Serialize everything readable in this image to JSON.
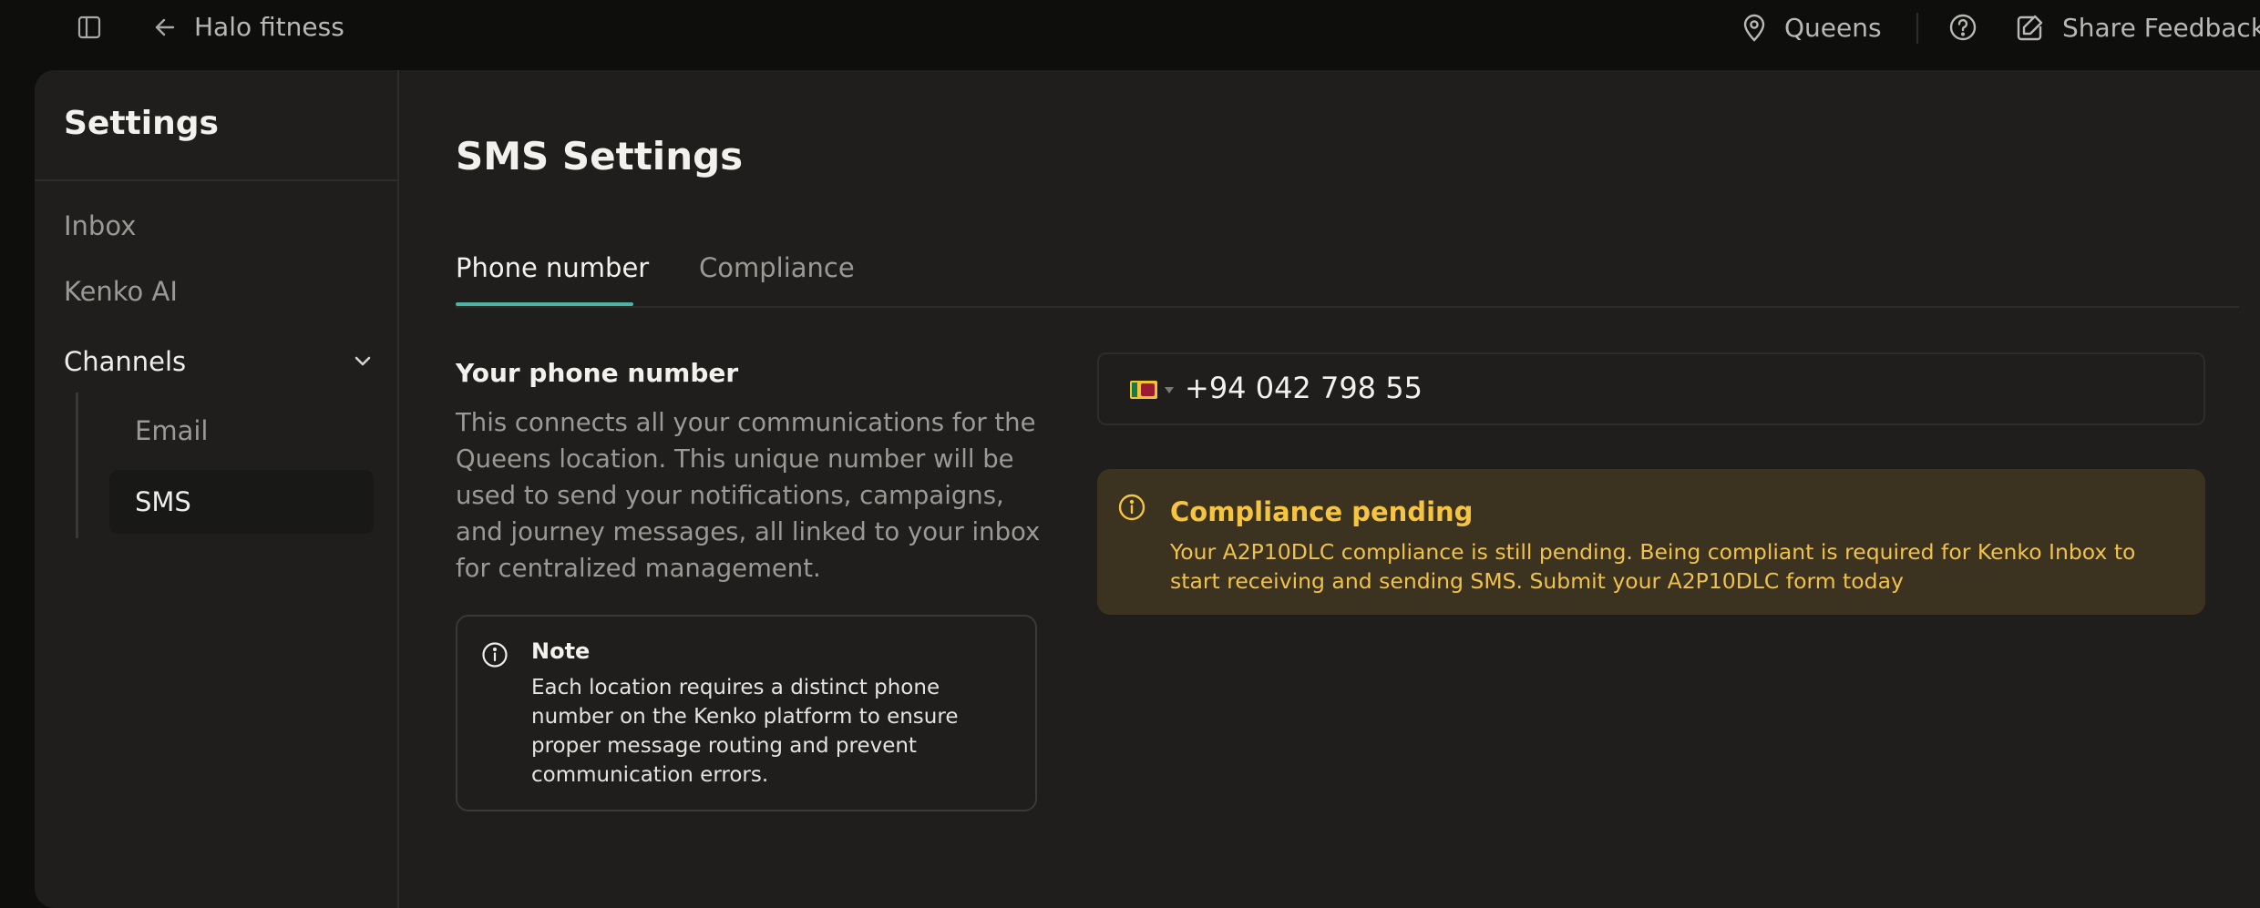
{
  "topbar": {
    "title": "Halo fitness",
    "location": "Queens",
    "feedback": "Share Feedback"
  },
  "sidebar": {
    "title": "Settings",
    "items": [
      {
        "label": "Inbox"
      },
      {
        "label": "Kenko AI"
      }
    ],
    "channels": {
      "label": "Channels",
      "children": [
        {
          "label": "Email"
        },
        {
          "label": "SMS",
          "selected": true
        }
      ]
    }
  },
  "main": {
    "title": "SMS Settings",
    "tabs": [
      {
        "label": "Phone number",
        "active": true
      },
      {
        "label": "Compliance"
      }
    ],
    "phone_section": {
      "title": "Your phone number",
      "description": "This connects all your communications for the Queens location. This unique number will be used to send your notifications, campaigns, and journey messages, all linked to your inbox for centralized management."
    },
    "note": {
      "title": "Note",
      "body": "Each location requires a distinct phone number on the Kenko platform to ensure proper message routing and prevent communication errors."
    },
    "phone_input": {
      "country": "Sri Lanka",
      "value": "+94 042 798 55"
    },
    "alert": {
      "title": "Compliance pending",
      "body": "Your A2P10DLC compliance is still pending. Being compliant is required for Kenko Inbox to start receiving and sending SMS. Submit your A2P10DLC form today"
    }
  },
  "colors": {
    "background": "#0e0e0d",
    "panel": "#1f1e1c",
    "accent": "#4fb3a3",
    "alert_bg": "#3b3220",
    "alert_text": "#f5c542"
  }
}
